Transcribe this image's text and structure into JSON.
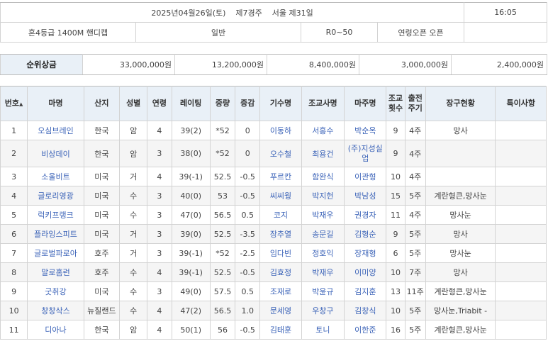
{
  "race_info": {
    "date_race": "2025년04월26일(토)    제7경주    서울 제31일",
    "time": "16:05",
    "grade": "혼4등급  1400M  핸디캡",
    "type": "일반",
    "rating": "R0~50",
    "age": "연령오픈 오픈"
  },
  "prize": {
    "label": "순위상금",
    "amounts": [
      "33,000,000원",
      "13,200,000원",
      "8,400,000원",
      "3,000,000원",
      "2,400,000원"
    ]
  },
  "table": {
    "sort_icon": "▲",
    "headers": [
      "번호",
      "마명",
      "산지",
      "성별",
      "연령",
      "레이팅",
      "중량",
      "증감",
      "기수명",
      "조교사명",
      "마주명",
      "조교횟수",
      "출전주기",
      "장구현황",
      "특이사항"
    ],
    "rows": [
      [
        "1",
        "오심브레인",
        "한국",
        "암",
        "4",
        "39(2)",
        "*52",
        "0",
        "이동하",
        "서홍수",
        "박순옥",
        "9",
        "4주",
        "망사",
        ""
      ],
      [
        "2",
        "비상데이",
        "한국",
        "암",
        "3",
        "38(0)",
        "*52",
        "0",
        "오수철",
        "최용건",
        "(주)지성실업",
        "9",
        "4주",
        "",
        ""
      ],
      [
        "3",
        "소울비트",
        "미국",
        "거",
        "4",
        "39(-1)",
        "52.5",
        "-0.5",
        "푸르칸",
        "함완식",
        "이관형",
        "10",
        "4주",
        "",
        ""
      ],
      [
        "4",
        "글로리영광",
        "미국",
        "수",
        "3",
        "40(0)",
        "53",
        "-0.5",
        "씨씨웡",
        "박지헌",
        "박남성",
        "15",
        "5주",
        "계란형큰,망사눈",
        ""
      ],
      [
        "5",
        "럭키프랭크",
        "미국",
        "수",
        "3",
        "47(0)",
        "56.5",
        "0.5",
        "코지",
        "박재우",
        "권경자",
        "11",
        "4주",
        "망사눈",
        ""
      ],
      [
        "6",
        "플라잉스피트",
        "미국",
        "거",
        "3",
        "39(0)",
        "52.5",
        "-3.5",
        "장추열",
        "송문길",
        "김형순",
        "9",
        "5주",
        "망사",
        ""
      ],
      [
        "7",
        "글로벌파로아",
        "호주",
        "거",
        "3",
        "39(-1)",
        "*52",
        "-2.5",
        "임다빈",
        "정호익",
        "장재형",
        "6",
        "5주",
        "망사눈",
        ""
      ],
      [
        "8",
        "말로홈런",
        "호주",
        "수",
        "4",
        "39(-1)",
        "52.5",
        "-0.5",
        "김효정",
        "박재우",
        "이미양",
        "10",
        "7주",
        "망사",
        ""
      ],
      [
        "9",
        "굿취강",
        "미국",
        "수",
        "3",
        "49(0)",
        "57.5",
        "0.5",
        "조재로",
        "박윤규",
        "김지훈",
        "13",
        "11주",
        "계란형큰,망사눈",
        ""
      ],
      [
        "10",
        "창창삭스",
        "뉴질랜드",
        "수",
        "4",
        "47(2)",
        "56.5",
        "1.0",
        "문세영",
        "우창구",
        "김창식",
        "10",
        "5주",
        "망사눈,Triabit -",
        ""
      ],
      [
        "11",
        "디아나",
        "한국",
        "암",
        "4",
        "50(1)",
        "56",
        "-0.5",
        "김태훈",
        "토니",
        "이한준",
        "16",
        "5주",
        "계란형큰,망사눈",
        ""
      ]
    ]
  },
  "colors": {
    "header_bg": "#e9f0f7",
    "link": "#3b63b8",
    "alt_row": "#f5f5f5"
  }
}
